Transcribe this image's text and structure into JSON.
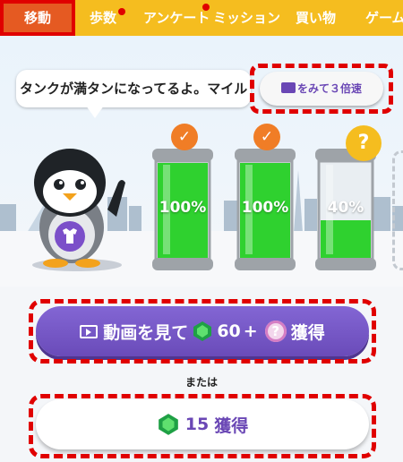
{
  "nav": {
    "tabs": [
      {
        "label": "移動",
        "active": true,
        "dot": false
      },
      {
        "label": "歩数",
        "active": false,
        "dot": true
      },
      {
        "label": "アンケート",
        "active": false,
        "dot": true
      },
      {
        "label": "ミッション",
        "active": false,
        "dot": false
      },
      {
        "label": "買い物",
        "active": false,
        "dot": false
      },
      {
        "label": "ゲーム",
        "active": false,
        "dot": false
      }
    ]
  },
  "message": {
    "text": "タンクが満タンになってるよ。マイル"
  },
  "speed_button": {
    "label": "をみて３倍速",
    "icon": "video-icon"
  },
  "tanks": [
    {
      "label": "100%",
      "fill": 1.0,
      "badge": "check"
    },
    {
      "label": "100%",
      "fill": 1.0,
      "badge": "check"
    },
    {
      "label": "40%",
      "fill": 0.4,
      "badge": "?"
    }
  ],
  "video_button": {
    "prefix": "動画を見て",
    "amount": "60",
    "plus": "+",
    "bonus_icon": "?",
    "suffix": "獲得"
  },
  "or_text": "または",
  "gem_button": {
    "amount": "15",
    "suffix": "獲得"
  },
  "colors": {
    "nav": "#f5bd1f",
    "accent_purple": "#6a47b5",
    "tank_green": "#2fd12f",
    "highlight_red": "#e00000"
  }
}
